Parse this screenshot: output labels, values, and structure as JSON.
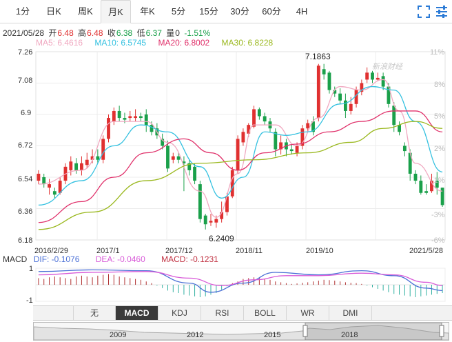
{
  "period_tabs": [
    "1分",
    "日K",
    "周K",
    "月K",
    "年K",
    "5分",
    "15分",
    "30分",
    "60分",
    "4H"
  ],
  "active_tab": "月K",
  "toolbar": {
    "fullscreen_icon": "expand-icon",
    "settings_icon": "gear-icon"
  },
  "quote": {
    "date": "2021/05/28",
    "open_label": "开",
    "open": "6.48",
    "high_label": "高",
    "high": "6.48",
    "close_label": "收",
    "close": "6.38",
    "low_label": "低",
    "low": "6.37",
    "volume_label": "量",
    "volume": "0",
    "change": "-1.51%"
  },
  "ma": [
    {
      "label": "MA5: 6.4616",
      "color": "#f0a8c0"
    },
    {
      "label": "MA10: 6.5745",
      "color": "#35c1e0"
    },
    {
      "label": "MA20: 6.8002",
      "color": "#e0306a"
    },
    {
      "label": "MA30: 6.8228",
      "color": "#9ab81e"
    }
  ],
  "chart_data": {
    "type": "candlestick",
    "y_left_ticks": [
      "7.26",
      "7.08",
      "6.9",
      "6.72",
      "6.54",
      "6.36",
      "6.18"
    ],
    "y_right_ticks": [
      "11%",
      "8%",
      "5%",
      "2%",
      "-1%",
      "-3%",
      "-6%"
    ],
    "x_ticks": [
      "2016/2/29",
      "2017/1",
      "2017/12",
      "2018/11",
      "2019/10",
      "2021/5/28"
    ],
    "annotations": [
      "7.1863",
      "6.2409"
    ],
    "watermark": "新浪财经",
    "up_color": "#e03030",
    "down_color": "#1aa04a",
    "candles": [
      [
        6.52,
        6.56,
        6.5,
        6.58
      ],
      [
        6.54,
        6.5,
        6.48,
        6.56
      ],
      [
        6.48,
        6.5,
        6.44,
        6.53
      ],
      [
        6.46,
        6.44,
        6.42,
        6.48
      ],
      [
        6.45,
        6.52,
        6.44,
        6.54
      ],
      [
        6.52,
        6.6,
        6.5,
        6.62
      ],
      [
        6.58,
        6.63,
        6.55,
        6.66
      ],
      [
        6.62,
        6.58,
        6.56,
        6.65
      ],
      [
        6.58,
        6.62,
        6.55,
        6.66
      ],
      [
        6.61,
        6.64,
        6.59,
        6.68
      ],
      [
        6.64,
        6.66,
        6.62,
        6.7
      ],
      [
        6.66,
        6.64,
        6.62,
        6.7
      ],
      [
        6.64,
        6.76,
        6.62,
        6.78
      ],
      [
        6.76,
        6.88,
        6.74,
        6.9
      ],
      [
        6.86,
        6.92,
        6.84,
        6.94
      ],
      [
        6.92,
        6.88,
        6.86,
        6.95
      ],
      [
        6.88,
        6.87,
        6.85,
        6.91
      ],
      [
        6.88,
        6.89,
        6.86,
        6.92
      ],
      [
        6.88,
        6.89,
        6.86,
        6.93
      ],
      [
        6.89,
        6.88,
        6.86,
        6.91
      ],
      [
        6.9,
        6.84,
        6.8,
        6.93
      ],
      [
        6.84,
        6.8,
        6.78,
        6.86
      ],
      [
        6.82,
        6.78,
        6.76,
        6.85
      ],
      [
        6.76,
        6.72,
        6.7,
        6.79
      ],
      [
        6.72,
        6.59,
        6.57,
        6.75
      ],
      [
        6.64,
        6.66,
        6.62,
        6.68
      ],
      [
        6.66,
        6.64,
        6.62,
        6.68
      ],
      [
        6.63,
        6.62,
        6.46,
        6.66
      ],
      [
        6.62,
        6.58,
        6.55,
        6.64
      ],
      [
        6.6,
        6.52,
        6.5,
        6.62
      ],
      [
        6.5,
        6.3,
        6.28,
        6.52
      ],
      [
        6.32,
        6.27,
        6.24,
        6.33
      ],
      [
        6.28,
        6.29,
        6.26,
        6.33
      ],
      [
        6.28,
        6.3,
        6.25,
        6.32
      ],
      [
        6.3,
        6.34,
        6.28,
        6.4
      ],
      [
        6.34,
        6.43,
        6.32,
        6.45
      ],
      [
        6.43,
        6.58,
        6.42,
        6.6
      ],
      [
        6.58,
        6.76,
        6.56,
        6.78
      ],
      [
        6.74,
        6.8,
        6.72,
        6.82
      ],
      [
        6.79,
        6.84,
        6.77,
        6.85
      ],
      [
        6.83,
        6.93,
        6.82,
        6.95
      ],
      [
        6.93,
        6.89,
        6.87,
        6.94
      ],
      [
        6.89,
        6.86,
        6.84,
        6.91
      ],
      [
        6.86,
        6.82,
        6.8,
        6.88
      ],
      [
        6.8,
        6.7,
        6.66,
        6.82
      ],
      [
        6.7,
        6.74,
        6.67,
        6.78
      ],
      [
        6.74,
        6.7,
        6.66,
        6.76
      ],
      [
        6.7,
        6.69,
        6.67,
        6.73
      ],
      [
        6.68,
        6.72,
        6.66,
        6.74
      ],
      [
        6.72,
        6.82,
        6.7,
        6.84
      ],
      [
        6.82,
        6.85,
        6.8,
        6.87
      ],
      [
        6.86,
        6.8,
        6.78,
        6.89
      ],
      [
        6.88,
        7.18,
        6.86,
        7.19
      ],
      [
        7.16,
        7.13,
        7.1,
        7.19
      ],
      [
        7.14,
        7.04,
        7.02,
        7.15
      ],
      [
        7.04,
        7.02,
        7.0,
        7.06
      ],
      [
        7.02,
        6.98,
        6.96,
        7.05
      ],
      [
        6.98,
        6.92,
        6.88,
        7.02
      ],
      [
        6.92,
        6.96,
        6.9,
        7.0
      ],
      [
        6.96,
        7.04,
        6.94,
        7.06
      ],
      [
        7.03,
        7.08,
        7.01,
        7.1
      ],
      [
        7.1,
        7.14,
        7.08,
        7.17
      ],
      [
        7.14,
        7.1,
        7.08,
        7.15
      ],
      [
        7.1,
        7.11,
        7.09,
        7.14
      ],
      [
        7.12,
        7.06,
        7.04,
        7.14
      ],
      [
        7.06,
        6.96,
        6.94,
        7.08
      ],
      [
        6.95,
        6.84,
        6.8,
        6.97
      ],
      [
        6.84,
        6.8,
        6.78,
        6.86
      ],
      [
        6.72,
        6.69,
        6.66,
        6.74
      ],
      [
        6.68,
        6.56,
        6.52,
        6.7
      ],
      [
        6.56,
        6.52,
        6.5,
        6.58
      ],
      [
        6.52,
        6.45,
        6.44,
        6.55
      ],
      [
        6.46,
        6.45,
        6.44,
        6.5
      ],
      [
        6.46,
        6.52,
        6.45,
        6.56
      ],
      [
        6.52,
        6.48,
        6.44,
        6.57
      ],
      [
        6.48,
        6.38,
        6.37,
        6.48
      ]
    ],
    "ma_series": [
      {
        "name": "MA5",
        "color": "#f0a8c0",
        "points": [
          [
            0,
            6.5
          ],
          [
            8,
            6.58
          ],
          [
            14,
            6.86
          ],
          [
            20,
            6.86
          ],
          [
            24,
            6.74
          ],
          [
            30,
            6.46
          ],
          [
            33,
            6.31
          ],
          [
            37,
            6.56
          ],
          [
            40,
            6.84
          ],
          [
            44,
            6.84
          ],
          [
            48,
            6.72
          ],
          [
            52,
            6.88
          ],
          [
            56,
            7.06
          ],
          [
            60,
            7.04
          ],
          [
            64,
            7.1
          ],
          [
            67,
            6.92
          ],
          [
            70,
            6.62
          ],
          [
            75,
            6.46
          ]
        ]
      },
      {
        "name": "MA10",
        "color": "#35c1e0",
        "points": [
          [
            0,
            6.38
          ],
          [
            8,
            6.52
          ],
          [
            14,
            6.72
          ],
          [
            19,
            6.84
          ],
          [
            24,
            6.8
          ],
          [
            30,
            6.6
          ],
          [
            34,
            6.42
          ],
          [
            38,
            6.54
          ],
          [
            42,
            6.8
          ],
          [
            46,
            6.78
          ],
          [
            50,
            6.8
          ],
          [
            56,
            6.96
          ],
          [
            62,
            7.06
          ],
          [
            66,
            7.04
          ],
          [
            70,
            6.86
          ],
          [
            75,
            6.57
          ]
        ]
      },
      {
        "name": "MA20",
        "color": "#e0306a",
        "points": [
          [
            0,
            6.28
          ],
          [
            8,
            6.4
          ],
          [
            14,
            6.54
          ],
          [
            20,
            6.68
          ],
          [
            27,
            6.76
          ],
          [
            32,
            6.68
          ],
          [
            37,
            6.58
          ],
          [
            42,
            6.68
          ],
          [
            48,
            6.73
          ],
          [
            54,
            6.8
          ],
          [
            60,
            6.86
          ],
          [
            66,
            6.92
          ],
          [
            70,
            6.92
          ],
          [
            75,
            6.8
          ]
        ]
      },
      {
        "name": "MA30",
        "color": "#9ab81e",
        "points": [
          [
            0,
            6.24
          ],
          [
            10,
            6.34
          ],
          [
            20,
            6.52
          ],
          [
            30,
            6.62
          ],
          [
            40,
            6.64
          ],
          [
            50,
            6.68
          ],
          [
            58,
            6.74
          ],
          [
            64,
            6.82
          ],
          [
            70,
            6.86
          ],
          [
            75,
            6.82
          ]
        ]
      }
    ],
    "macd": {
      "label": "MACD",
      "dif_label": "DIF: -0.1076",
      "dif_color": "#4a6fd6",
      "dea_label": "DEA: -0.0460",
      "dea_color": "#d85ad8",
      "macd_label": "MACD: -0.1231",
      "macd_color": "#c03040",
      "y_ticks": [
        "1",
        "-1"
      ],
      "dif": [
        [
          0,
          0.8
        ],
        [
          10,
          0.9
        ],
        [
          20,
          0.85
        ],
        [
          28,
          0.1
        ],
        [
          32,
          -0.45
        ],
        [
          38,
          0.1
        ],
        [
          44,
          0.75
        ],
        [
          52,
          0.6
        ],
        [
          60,
          0.85
        ],
        [
          66,
          0.55
        ],
        [
          72,
          -0.2
        ],
        [
          75,
          -0.35
        ]
      ],
      "dea": [
        [
          0,
          0.6
        ],
        [
          10,
          0.75
        ],
        [
          20,
          0.8
        ],
        [
          28,
          0.4
        ],
        [
          34,
          -0.05
        ],
        [
          40,
          0.3
        ],
        [
          46,
          0.55
        ],
        [
          52,
          0.55
        ],
        [
          60,
          0.7
        ],
        [
          66,
          0.6
        ],
        [
          72,
          0.15
        ],
        [
          75,
          -0.05
        ]
      ],
      "bars": [
        0.4,
        0.35,
        0.45,
        0.5,
        0.45,
        0.4,
        0.35,
        0.5,
        0.55,
        0.5,
        0.45,
        0.55,
        0.6,
        0.65,
        0.6,
        0.5,
        0.45,
        0.4,
        0.35,
        0.3,
        0.2,
        0.1,
        -0.05,
        -0.2,
        -0.35,
        -0.45,
        -0.5,
        -0.6,
        -0.65,
        -0.7,
        -0.75,
        -0.7,
        -0.6,
        -0.5,
        -0.3,
        -0.1,
        0.1,
        0.2,
        0.35,
        0.4,
        0.45,
        0.4,
        0.35,
        0.3,
        0.2,
        0.15,
        0.1,
        0.05,
        0.08,
        0.12,
        0.15,
        0.2,
        0.25,
        0.3,
        0.28,
        0.25,
        0.2,
        0.15,
        0.12,
        0.1,
        0.05,
        -0.05,
        -0.15,
        -0.25,
        -0.35,
        -0.45,
        -0.55,
        -0.6,
        -0.65,
        -0.7,
        -0.75,
        -0.7,
        -0.65,
        -0.6,
        -0.55,
        -0.5
      ]
    },
    "nav_years": [
      "2009",
      "2012",
      "2015",
      "2018"
    ]
  },
  "indicator_tabs": [
    "无",
    "MACD",
    "KDJ",
    "RSI",
    "BOLL",
    "WR",
    "DMI"
  ],
  "active_indicator": "MACD",
  "nav_arrows": {
    "up": "▲",
    "down": "▼"
  }
}
